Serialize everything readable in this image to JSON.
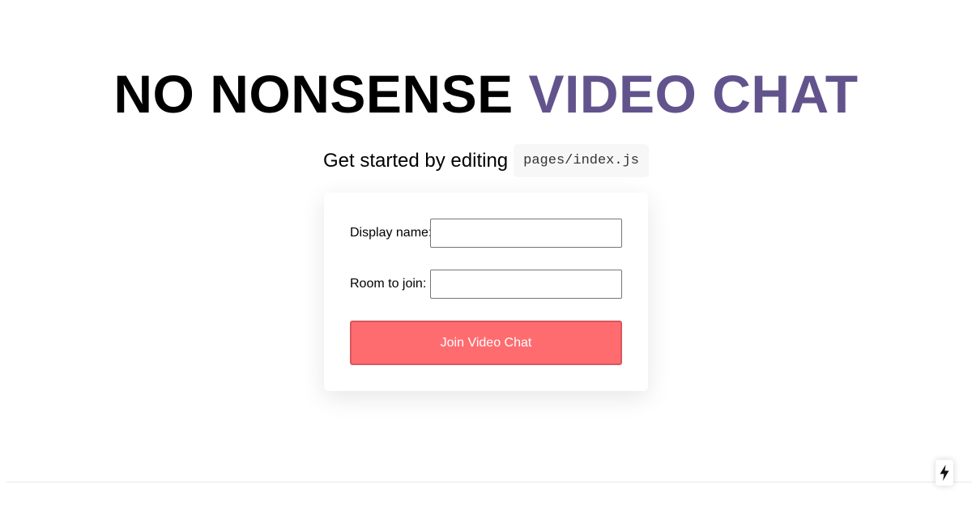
{
  "header": {
    "title_main": "NO NONSENSE",
    "title_accent": "VIDEO CHAT",
    "subtitle_text": "Get started by editing",
    "subtitle_code": "pages/index.js"
  },
  "form": {
    "display_name_label": "Display name:",
    "display_name_value": "",
    "room_label": "Room to join:",
    "room_value": "",
    "join_label": "Join Video Chat"
  },
  "build_indicator": {
    "icon": "lightning-bolt-icon"
  },
  "colors": {
    "accent": "#62538d",
    "button": "#ff6c6f"
  }
}
